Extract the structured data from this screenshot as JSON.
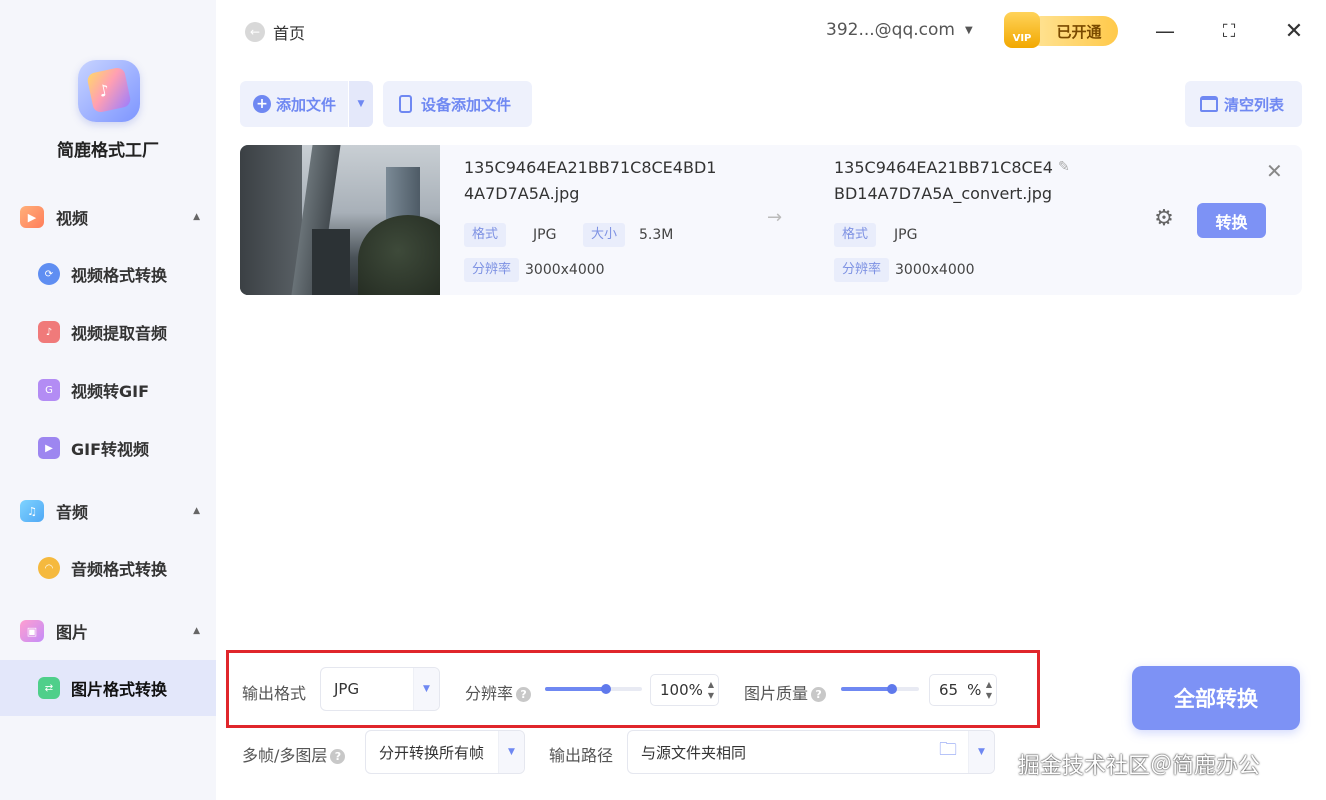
{
  "app": {
    "name": "简鹿格式工厂"
  },
  "sidebar": {
    "sections": [
      {
        "label": "视频",
        "items": [
          "视频格式转换",
          "视频提取音频",
          "视频转GIF",
          "GIF转视频"
        ]
      },
      {
        "label": "音频",
        "items": [
          "音频格式转换"
        ]
      },
      {
        "label": "图片",
        "items": [
          "图片格式转换"
        ]
      }
    ],
    "active_item": "图片格式转换"
  },
  "header": {
    "back_label": "首页",
    "account": "392...@qq.com",
    "vip_badge": "VIP",
    "vip_status": "已开通"
  },
  "toolbar": {
    "add_file": "添加文件",
    "device_add": "设备添加文件",
    "clear_list": "清空列表"
  },
  "file": {
    "source_name": [
      "135C9464EA21BB71C8CE4BD1",
      "4A7D7A5A.jpg"
    ],
    "target_name": [
      "135C9464EA21BB71C8CE4",
      "BD14A7D7A5A_convert.jpg"
    ],
    "format_tag": "格式",
    "size_tag": "大小",
    "resolution_tag": "分辨率",
    "source_format": "JPG",
    "source_size": "5.3M",
    "source_resolution": "3000x4000",
    "target_format": "JPG",
    "target_resolution": "3000x4000",
    "convert_label": "转换"
  },
  "settings": {
    "output_format_label": "输出格式",
    "output_format_value": "JPG",
    "resolution_label": "分辨率",
    "resolution_value": "100%",
    "resolution_level": 0.63,
    "quality_label": "图片质量",
    "quality_value": "65",
    "quality_unit": "%",
    "quality_level": 0.65,
    "multiframe_label": "多帧/多图层",
    "multiframe_value": "分开转换所有帧",
    "output_path_label": "输出路径",
    "output_path_value": "与源文件夹相同",
    "convert_all_label": "全部转换"
  },
  "watermark": "掘金技术社区＠简鹿办公",
  "colors": {
    "accent": "#7d92f5",
    "vip_gold": "#ffc94a",
    "highlight_box": "#e0262b"
  }
}
